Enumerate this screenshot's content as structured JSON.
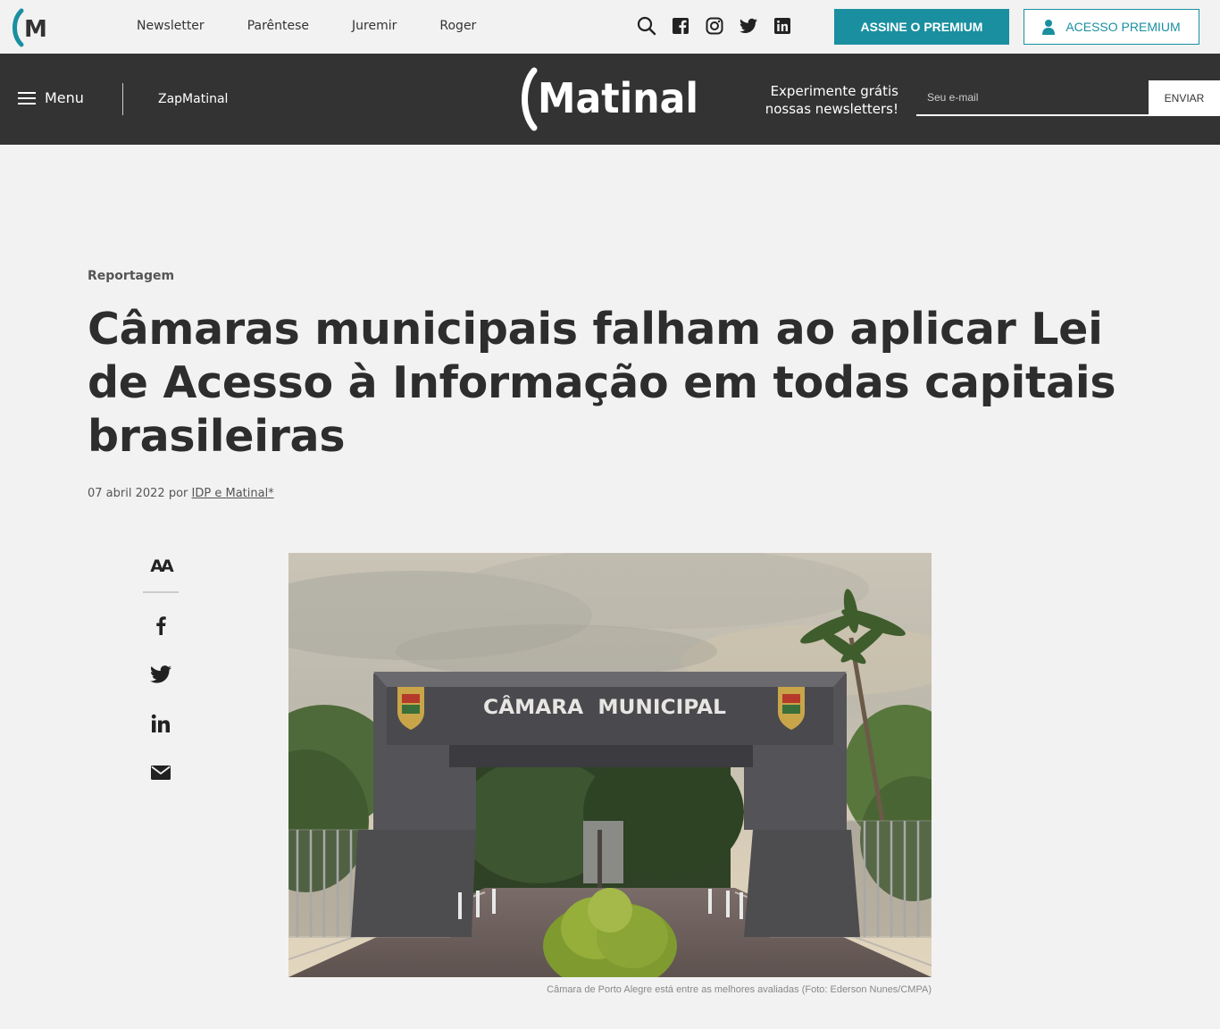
{
  "topbar": {
    "nav": [
      "Newsletter",
      "Parêntese",
      "Juremir",
      "Roger"
    ],
    "social_icons": [
      "search-icon",
      "facebook-icon",
      "instagram-icon",
      "twitter-icon",
      "linkedin-icon"
    ],
    "subscribe_label": "ASSINE O PREMIUM",
    "premium_access_label": "ACESSO PREMIUM"
  },
  "header": {
    "menu_label": "Menu",
    "zap_label": "ZapMatinal",
    "brand": "Matinal",
    "newsletter_cta_line1": "Experimente grátis",
    "newsletter_cta_line2": "nossas newsletters!",
    "email_placeholder": "Seu e-mail",
    "send_label": "ENVIAR"
  },
  "article": {
    "category": "Reportagem",
    "title": "Câmaras municipais falham ao aplicar Lei de Acesso à Informação em todas capitais brasileiras",
    "date": "07 abril 2022",
    "by": "por",
    "author": "IDP e Matinal*",
    "image_sign_text": "CÂMARA  MUNICIPAL",
    "caption": "Câmara de Porto Alegre está entre as melhores avaliadas (Foto: Ederson Nunes/CMPA)"
  },
  "share": {
    "font_size_label": "AA",
    "icons": [
      "font-size-icon",
      "facebook-icon",
      "twitter-icon",
      "linkedin-icon",
      "email-icon"
    ]
  },
  "colors": {
    "accent": "#1a8fa0",
    "header_bg": "#333333",
    "page_bg": "#f2f2f2"
  }
}
